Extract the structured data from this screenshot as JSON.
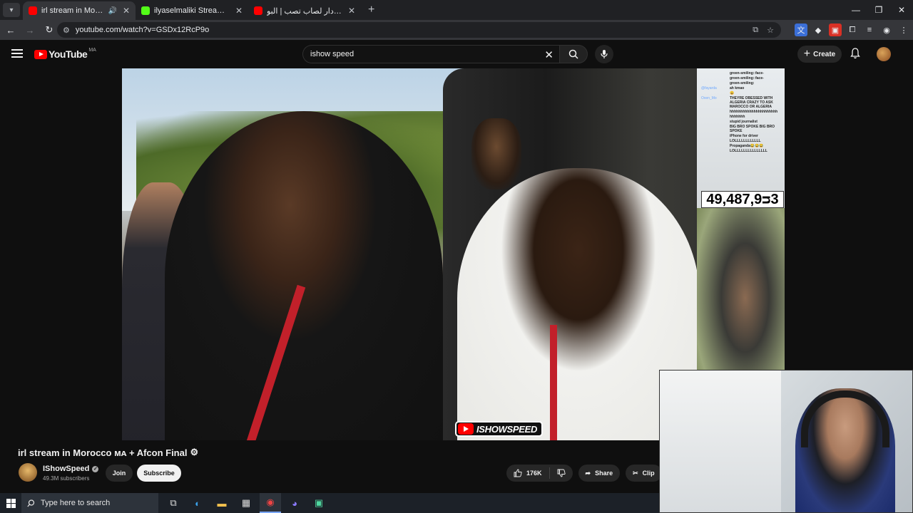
{
  "browser": {
    "tabs": [
      {
        "title": "irl stream in Morocco ᴍᴀ + ",
        "favicon": "youtube-icon",
        "color": "#ff0000",
        "active": true,
        "audio": true
      },
      {
        "title": "ilyaselmaliki Stream - Watch Liv",
        "favicon": "kick-icon",
        "color": "#53fc18",
        "active": false
      },
      {
        "title": "عمر تيستو دار لصاب تصب | البو...",
        "favicon": "youtube-icon",
        "color": "#ff0000",
        "active": false
      }
    ],
    "url": "youtube.com/watch?v=GSDx12RcP9o"
  },
  "youtube": {
    "logo_text": "YouTube",
    "country_code": "MA",
    "search_query": "ishow speed",
    "create_label": "Create"
  },
  "video": {
    "chat": [
      {
        "user": "",
        "msg": "green-smiling::face-"
      },
      {
        "user": "",
        "msg": "green-smiling::face-"
      },
      {
        "user": "",
        "msg": "green-smiling:"
      },
      {
        "user": "@fayarda",
        "msg": "ah kmao"
      },
      {
        "user": "",
        "msg": "😀"
      },
      {
        "user": "Oxen_Mo",
        "msg": "THEYRE OBESSED WITH ALGERIA CRAZY TO ASK MAROCCO OR ALGERIA"
      },
      {
        "user": "",
        "msg": "hhhhhhhhhhhhhhhhhhhhhh"
      },
      {
        "user": "",
        "msg": "hhhhhhh"
      },
      {
        "user": "",
        "msg": "stupid journalist"
      },
      {
        "user": "",
        "msg": "BIG BRO SPOKE BIG BRO SPOKE"
      },
      {
        "user": "",
        "msg": "iPhone for driver"
      },
      {
        "user": "",
        "msg": "LOLLLLLLLLLLLL"
      },
      {
        "user": "",
        "msg": "Propaganda😂😂😂"
      },
      {
        "user": "",
        "msg": "LOLLLLLLLLLLLLLLL"
      }
    ],
    "viewer_counter": "49,487,9ᴝ3",
    "watermark": "ISHOWSPEED",
    "title": "irl stream in Morocco ᴍᴀ + Afcon Final"
  },
  "channel": {
    "name": "IShowSpeed",
    "subscribers": "49.3M subscribers",
    "join_label": "Join",
    "subscribe_label": "Subscribe"
  },
  "actions": {
    "likes": "176K",
    "share_label": "Share",
    "clip_label": "Clip"
  },
  "taskbar": {
    "search_placeholder": "Type here to search"
  }
}
